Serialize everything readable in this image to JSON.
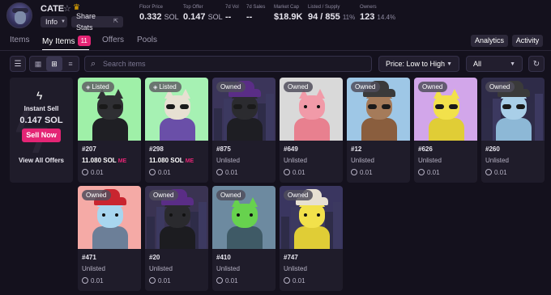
{
  "collection": {
    "name": "CATE",
    "info_label": "Info",
    "share_label": "Share Stats"
  },
  "stats": {
    "floor": {
      "label": "Floor Price",
      "value": "0.332",
      "unit": "SOL"
    },
    "top_offer": {
      "label": "Top Offer",
      "value": "0.147",
      "unit": "SOL"
    },
    "vol_7d": {
      "label": "7d Vol",
      "value": "--"
    },
    "sales_7d": {
      "label": "7d Sales",
      "value": "--"
    },
    "market_cap": {
      "label": "Market Cap",
      "value": "$18.9K"
    },
    "listed_supply": {
      "label": "Listed / Supply",
      "value": "94 / 855",
      "pct": "11%"
    },
    "owners": {
      "label": "Owners",
      "value": "123",
      "pct": "14.4%"
    }
  },
  "tabs": {
    "items": "Items",
    "my_items": "My Items",
    "my_items_count": "11",
    "offers": "Offers",
    "pools": "Pools"
  },
  "actions": {
    "analytics": "Analytics",
    "activity": "Activity"
  },
  "toolbar": {
    "search_placeholder": "Search items",
    "sort_value": "Price: Low to High",
    "filter_value": "All"
  },
  "instant_sell": {
    "title": "Instant Sell",
    "price": "0.147 SOL",
    "button": "Sell Now",
    "view_all": "View All Offers"
  },
  "cards": [
    {
      "badge": "Listed",
      "number": "#207",
      "status": "11.080 SOL",
      "marketplace": "ME",
      "offer": "0.01",
      "bg": "#9ff0a8",
      "fur": "#2f2f33",
      "outfit": "#1f1f24"
    },
    {
      "badge": "Listed",
      "number": "#298",
      "status": "11.080 SOL",
      "marketplace": "ME",
      "offer": "0.01",
      "bg": "#a6f1b3",
      "fur": "#e7e0d2",
      "outfit": "#6a4fa8"
    },
    {
      "badge": "Owned",
      "number": "#875",
      "status": "Unlisted",
      "offer": "0.01",
      "bg": "#3b355a",
      "fur": "#2b2b2f",
      "outfit": "#1e1e23"
    },
    {
      "badge": "Owned",
      "number": "#649",
      "status": "Unlisted",
      "offer": "0.01",
      "bg": "#d9d9d9",
      "fur": "#f19aa8",
      "outfit": "#e8808f"
    },
    {
      "badge": "Owned",
      "number": "#12",
      "status": "Unlisted",
      "offer": "0.01",
      "bg": "#9ec7e6",
      "fur": "#a57b5a",
      "outfit": "#8a5e3e"
    },
    {
      "badge": "Owned",
      "number": "#626",
      "status": "Unlisted",
      "offer": "0.01",
      "bg": "#d2a6ea",
      "fur": "#f2e14b",
      "outfit": "#e0cd36"
    },
    {
      "badge": "Owned",
      "number": "#260",
      "status": "Unlisted",
      "offer": "0.01",
      "bg": "#2e2b48",
      "fur": "#a9cfe8",
      "outfit": "#8db8d6"
    },
    {
      "badge": "Owned",
      "number": "#471",
      "status": "Unlisted",
      "offer": "0.01",
      "bg": "#f5aaa6",
      "fur": "#a8d6ef",
      "outfit": "#6c7f98"
    },
    {
      "badge": "Owned",
      "number": "#20",
      "status": "Unlisted",
      "offer": "0.01",
      "bg": "#3a3352",
      "fur": "#2a2a2e",
      "outfit": "#1c1c20"
    },
    {
      "badge": "Owned",
      "number": "#410",
      "status": "Unlisted",
      "offer": "0.01",
      "bg": "#6d8aa0",
      "fur": "#67d24e",
      "outfit": "#3f5a66"
    },
    {
      "badge": "Owned",
      "number": "#747",
      "status": "Unlisted",
      "offer": "0.01",
      "bg": "#3a3660",
      "fur": "#f2e14b",
      "outfit": "#e0cd36"
    }
  ],
  "colors": {
    "accent": "#e42575",
    "background": "#14111d",
    "card": "#1f1c2a",
    "crown": "#f4b400"
  },
  "icons": [
    "star-icon",
    "crown-icon",
    "share-icon",
    "filter-icon",
    "grid-large-icon",
    "grid-small-icon",
    "list-icon",
    "search-icon",
    "refresh-icon",
    "bolt-icon",
    "tag-icon",
    "offer-icon",
    "magic-eden-icon"
  ]
}
